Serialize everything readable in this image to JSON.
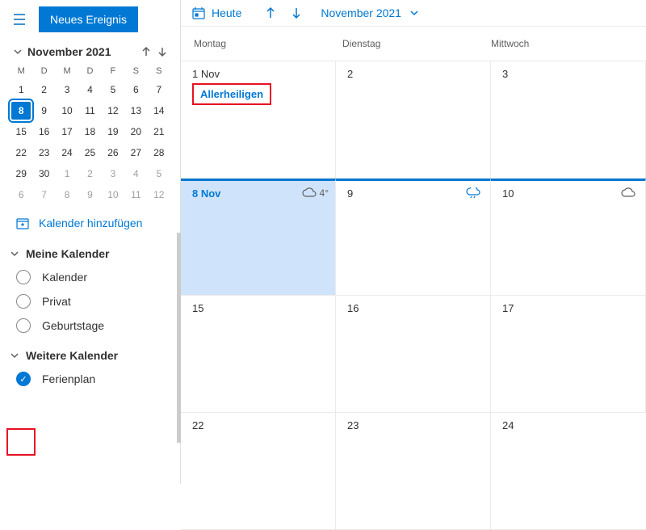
{
  "sidebar": {
    "newEvent": "Neues Ereignis",
    "monthTitle": "November 2021",
    "dow": [
      "M",
      "D",
      "M",
      "D",
      "F",
      "S",
      "S"
    ],
    "days": [
      {
        "n": "1"
      },
      {
        "n": "2"
      },
      {
        "n": "3"
      },
      {
        "n": "4"
      },
      {
        "n": "5"
      },
      {
        "n": "6"
      },
      {
        "n": "7"
      },
      {
        "n": "8",
        "sel": true
      },
      {
        "n": "9"
      },
      {
        "n": "10"
      },
      {
        "n": "11"
      },
      {
        "n": "12"
      },
      {
        "n": "13"
      },
      {
        "n": "14"
      },
      {
        "n": "15"
      },
      {
        "n": "16"
      },
      {
        "n": "17"
      },
      {
        "n": "18"
      },
      {
        "n": "19"
      },
      {
        "n": "20"
      },
      {
        "n": "21"
      },
      {
        "n": "22"
      },
      {
        "n": "23"
      },
      {
        "n": "24"
      },
      {
        "n": "25"
      },
      {
        "n": "26"
      },
      {
        "n": "27"
      },
      {
        "n": "28"
      },
      {
        "n": "29"
      },
      {
        "n": "30"
      },
      {
        "n": "1",
        "out": true
      },
      {
        "n": "2",
        "out": true
      },
      {
        "n": "3",
        "out": true
      },
      {
        "n": "4",
        "out": true
      },
      {
        "n": "5",
        "out": true
      },
      {
        "n": "6",
        "out": true
      },
      {
        "n": "7",
        "out": true
      },
      {
        "n": "8",
        "out": true
      },
      {
        "n": "9",
        "out": true
      },
      {
        "n": "10",
        "out": true
      },
      {
        "n": "11",
        "out": true
      },
      {
        "n": "12",
        "out": true
      }
    ],
    "addCalendar": "Kalender hinzufügen",
    "myCalendars": "Meine Kalender",
    "cal1": "Kalender",
    "cal2": "Privat",
    "cal3": "Geburtstage",
    "otherCalendars": "Weitere Kalender",
    "cal4": "Ferienplan"
  },
  "main": {
    "today": "Heute",
    "month": "November 2021",
    "dow1": "Montag",
    "dow2": "Dienstag",
    "dow3": "Mittwoch",
    "cells": {
      "c1": "1 Nov",
      "c2": "2",
      "c3": "3",
      "c4": "8 Nov",
      "c5": "9",
      "c6": "10",
      "c7": "15",
      "c8": "16",
      "c9": "17",
      "c10": "22",
      "c11": "23",
      "c12": "24"
    },
    "event1": "Allerheiligen",
    "temp": "4°"
  }
}
